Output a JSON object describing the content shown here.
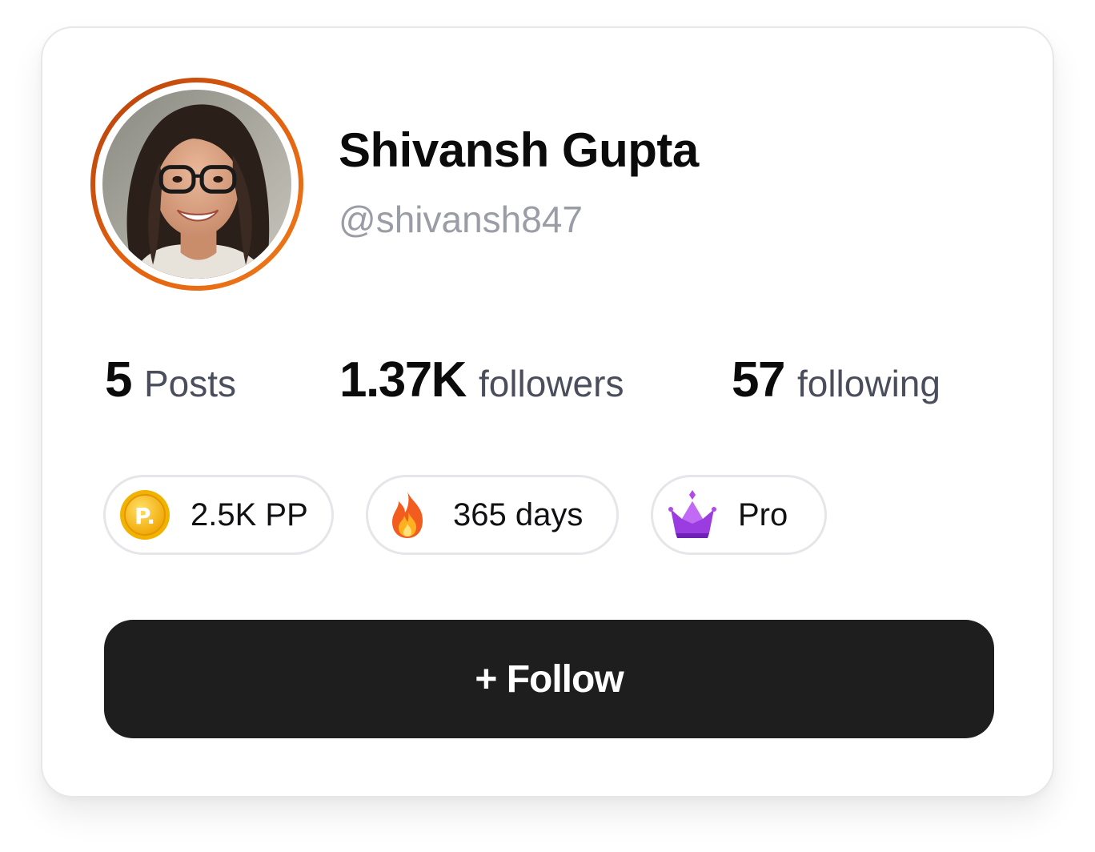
{
  "profile": {
    "name": "Shivansh Gupta",
    "handle": "@shivansh847",
    "avatar_ring_color": "#e2600f"
  },
  "stats": [
    {
      "value": "5",
      "label": "Posts"
    },
    {
      "value": "1.37K",
      "label": "followers"
    },
    {
      "value": "57",
      "label": "following"
    }
  ],
  "badges": [
    {
      "icon": "coin-icon",
      "label": "2.5K PP"
    },
    {
      "icon": "fire-icon",
      "label": "365 days"
    },
    {
      "icon": "crown-icon",
      "label": "Pro"
    }
  ],
  "actions": {
    "follow_label": "+ Follow",
    "follow_bg": "#1e1e1e"
  }
}
